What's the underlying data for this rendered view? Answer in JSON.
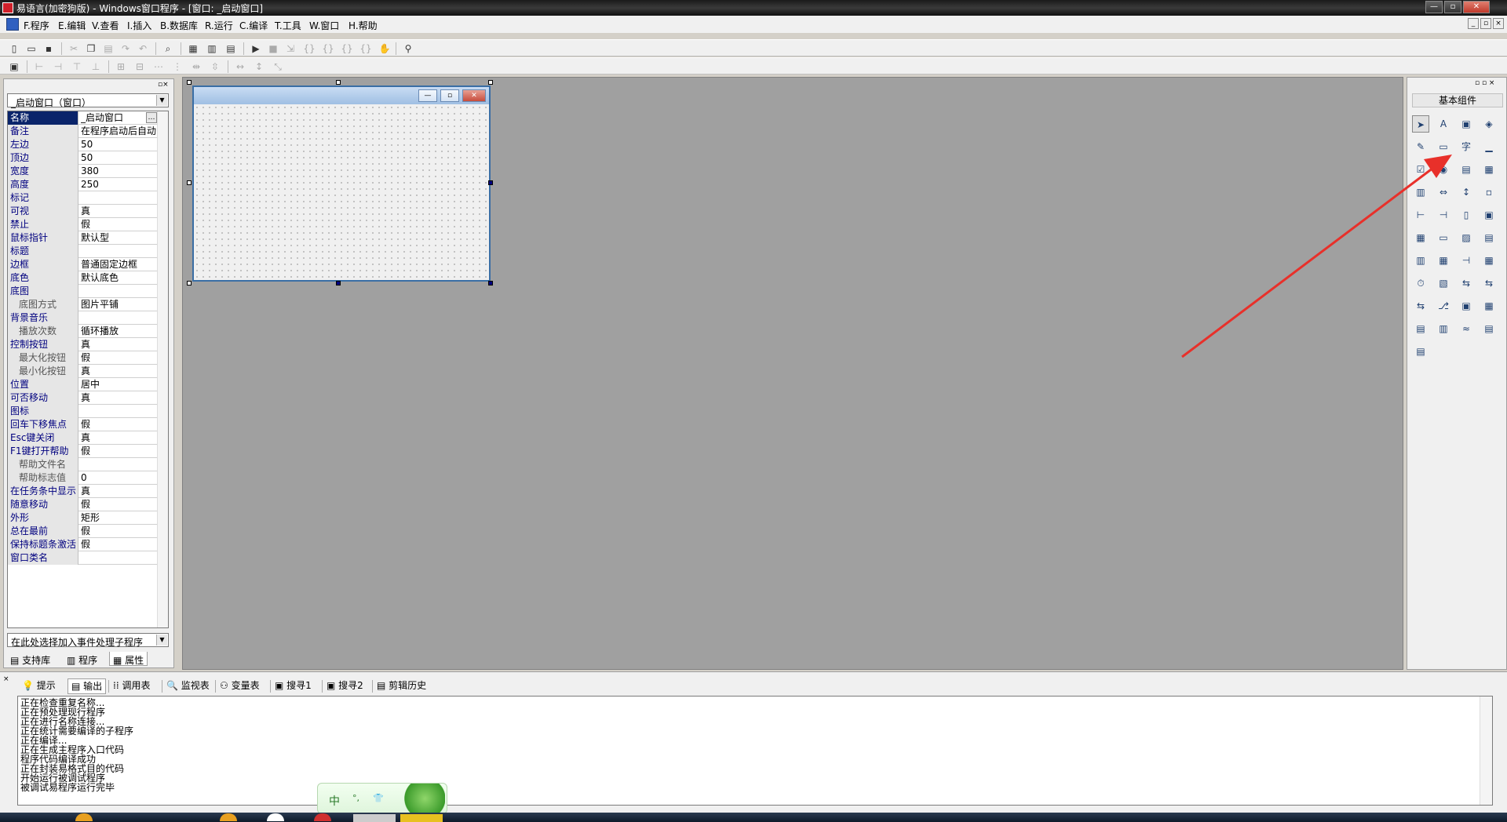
{
  "window": {
    "title": "易语言(加密狗版) - Windows窗口程序 - [窗口: _启动窗口]"
  },
  "menu": [
    "F.程序",
    "E.编辑",
    "V.查看",
    "I.插入",
    "B.数据库",
    "R.运行",
    "C.编译",
    "T.工具",
    "W.窗口",
    "H.帮助"
  ],
  "left_panel": {
    "object_select": "_启动窗口（窗口）",
    "event_select": "在此处选择加入事件处理子程序",
    "properties": [
      {
        "name": "名称",
        "value": "_启动窗口",
        "sub": false,
        "selected": true
      },
      {
        "name": "备注",
        "value": "在程序启动后自动",
        "sub": false
      },
      {
        "name": "左边",
        "value": "50",
        "sub": false
      },
      {
        "name": "顶边",
        "value": "50",
        "sub": false
      },
      {
        "name": "宽度",
        "value": "380",
        "sub": false
      },
      {
        "name": "高度",
        "value": "250",
        "sub": false
      },
      {
        "name": "标记",
        "value": "",
        "sub": false
      },
      {
        "name": "可视",
        "value": "真",
        "sub": false
      },
      {
        "name": "禁止",
        "value": "假",
        "sub": false
      },
      {
        "name": "鼠标指针",
        "value": "默认型",
        "sub": false
      },
      {
        "name": "标题",
        "value": "",
        "sub": false
      },
      {
        "name": "边框",
        "value": "普通固定边框",
        "sub": false
      },
      {
        "name": "底色",
        "value": "默认底色",
        "sub": false
      },
      {
        "name": "底图",
        "value": "",
        "sub": false
      },
      {
        "name": "底图方式",
        "value": "图片平铺",
        "sub": true
      },
      {
        "name": "背景音乐",
        "value": "",
        "sub": false
      },
      {
        "name": "播放次数",
        "value": "循环播放",
        "sub": true
      },
      {
        "name": "控制按钮",
        "value": "真",
        "sub": false
      },
      {
        "name": "最大化按钮",
        "value": "假",
        "sub": true
      },
      {
        "name": "最小化按钮",
        "value": "真",
        "sub": true
      },
      {
        "name": "位置",
        "value": "居中",
        "sub": false
      },
      {
        "name": "可否移动",
        "value": "真",
        "sub": false
      },
      {
        "name": "图标",
        "value": "",
        "sub": false
      },
      {
        "name": "回车下移焦点",
        "value": "假",
        "sub": false
      },
      {
        "name": "Esc键关闭",
        "value": "真",
        "sub": false
      },
      {
        "name": "F1键打开帮助",
        "value": "假",
        "sub": false
      },
      {
        "name": "帮助文件名",
        "value": "",
        "sub": true
      },
      {
        "name": "帮助标志值",
        "value": "0",
        "sub": true
      },
      {
        "name": "在任务条中显示",
        "value": "真",
        "sub": false
      },
      {
        "name": "随意移动",
        "value": "假",
        "sub": false
      },
      {
        "name": "外形",
        "value": "矩形",
        "sub": false
      },
      {
        "name": "总在最前",
        "value": "假",
        "sub": false
      },
      {
        "name": "保持标题条激活",
        "value": "假",
        "sub": false
      },
      {
        "name": "窗口类名",
        "value": "",
        "sub": false
      }
    ],
    "tabs": [
      "支持库",
      "程序",
      "属性"
    ]
  },
  "right_panel": {
    "title": "基本组件"
  },
  "bottom_panel": {
    "tabs": [
      "提示",
      "输出",
      "调用表",
      "监视表",
      "变量表",
      "搜寻1",
      "搜寻2",
      "剪辑历史"
    ],
    "output_lines": [
      "正在检查重复名称...",
      "正在预处理现行程序",
      "正在进行名称连接...",
      "正在统计需要编译的子程序",
      "正在编译...",
      "正在生成主程序入口代码",
      "程序代码编译成功",
      "正在封装易格式目的代码",
      "开始运行被调试程序",
      "被调试易程序运行完毕"
    ]
  },
  "ime": {
    "mode": "中",
    "punct": "°,",
    "skin": "👕"
  },
  "colors": {
    "accent": "#0a246a",
    "arrow": "#e8302a",
    "design_bg": "#a0a0a0"
  }
}
